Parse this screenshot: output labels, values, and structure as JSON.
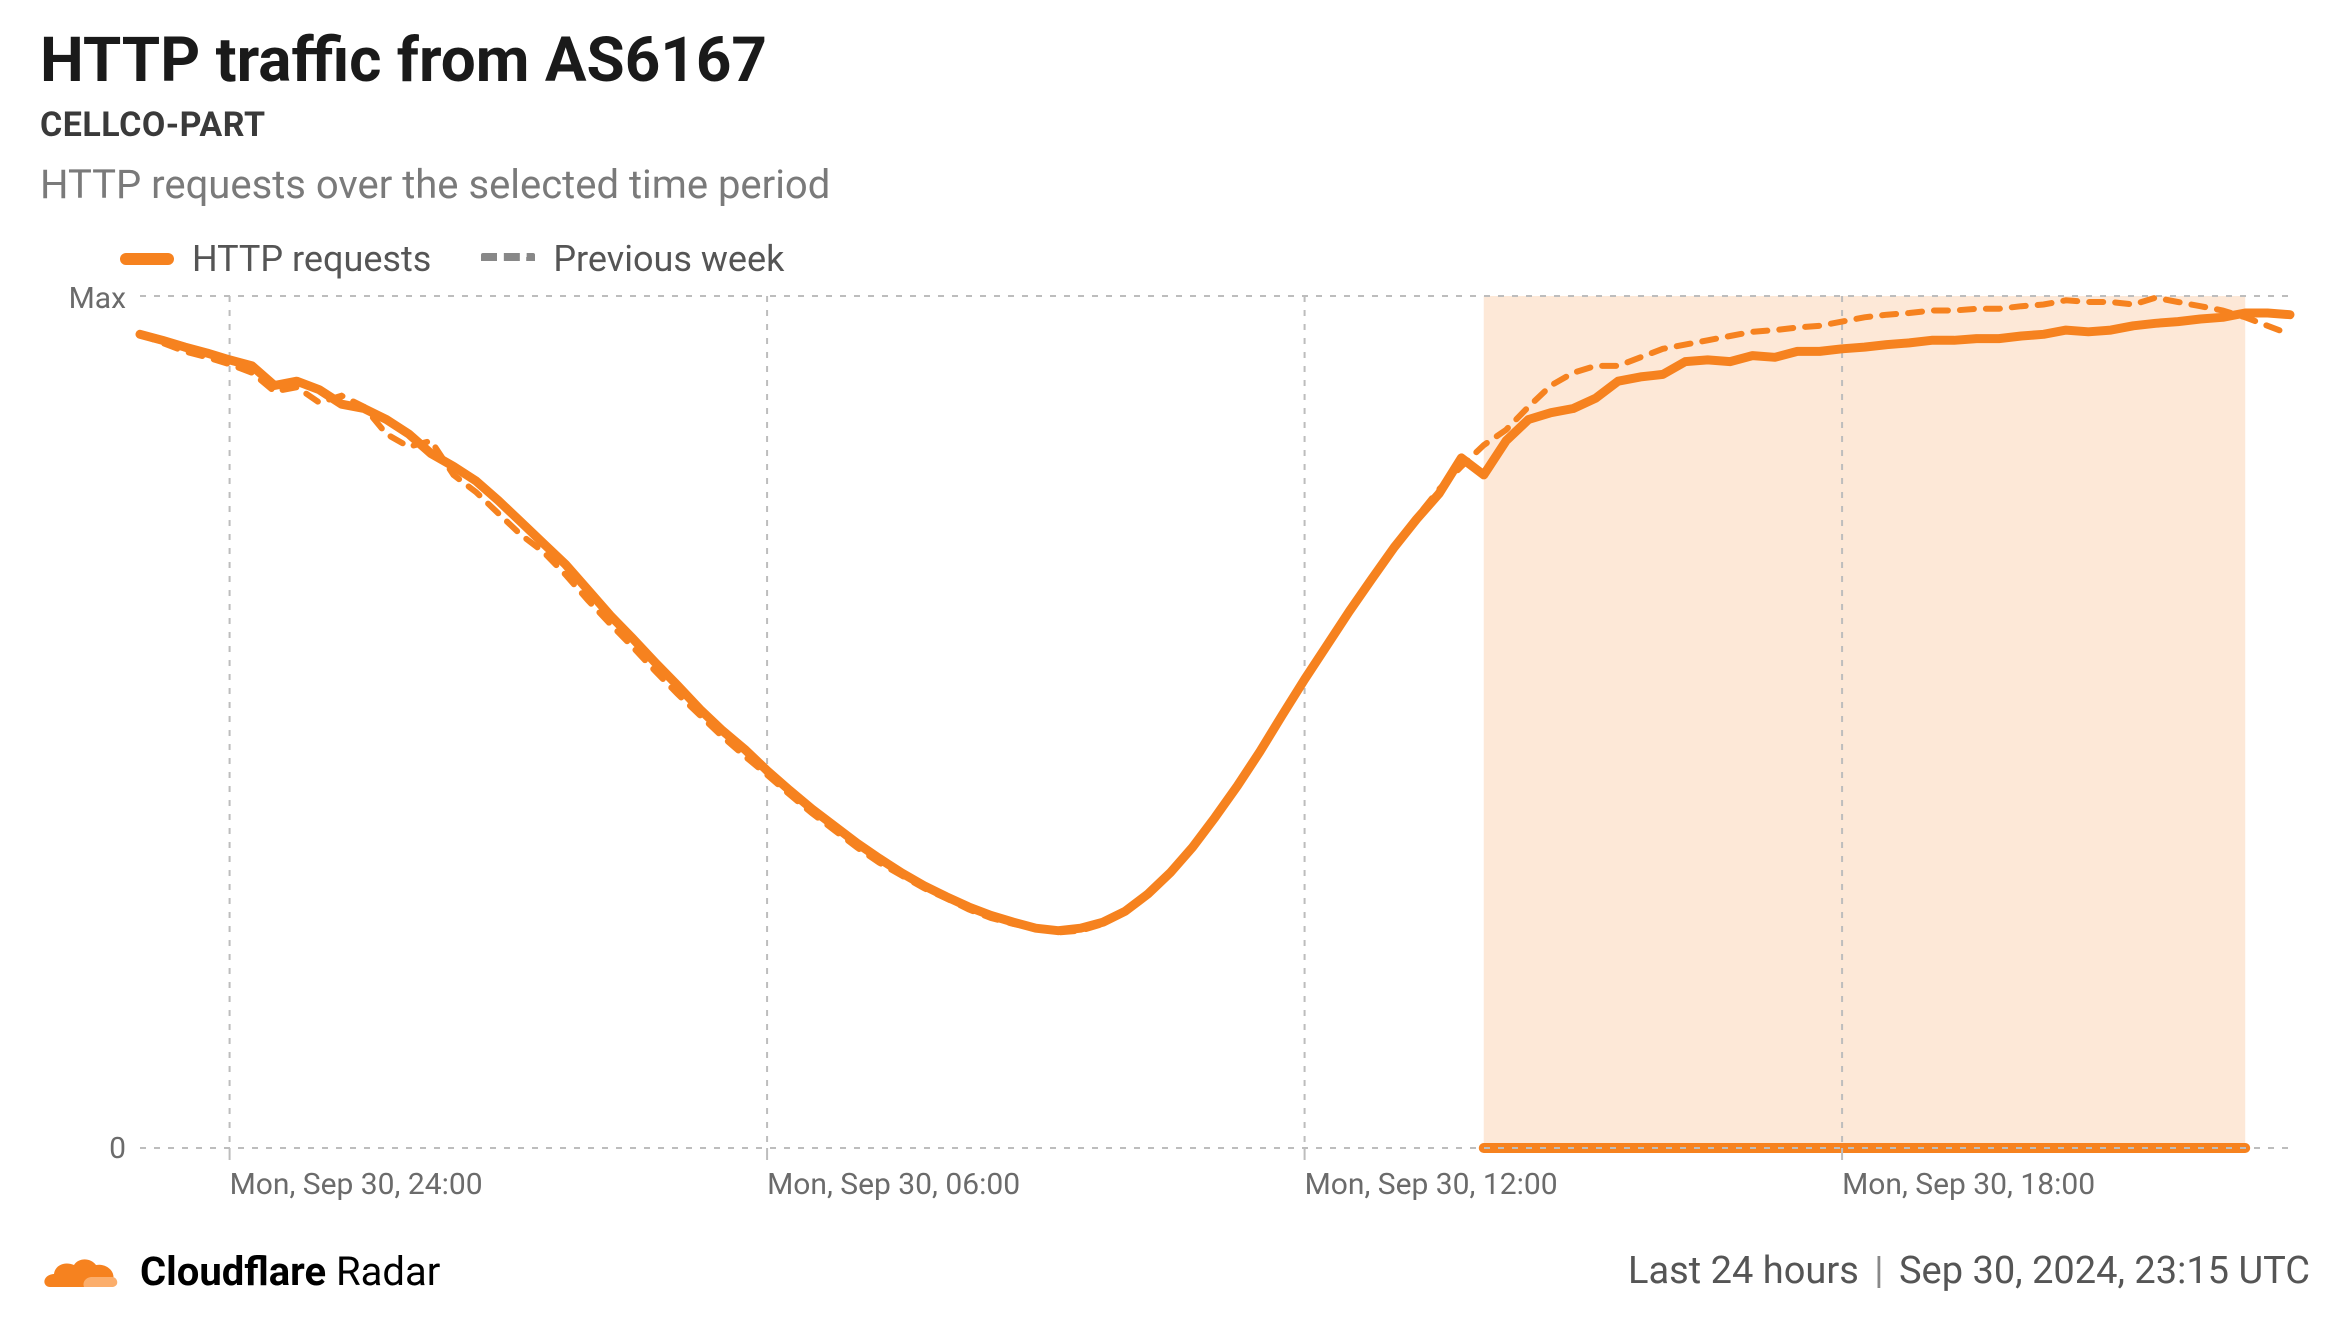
{
  "title": "HTTP traffic from AS6167",
  "subtitle": "CELLCO-PART",
  "description": "HTTP requests over the selected time period",
  "legend": {
    "series1": "HTTP requests",
    "series2": "Previous week"
  },
  "footer": {
    "brand_bold": "Cloudflare",
    "brand_rest": " Radar",
    "range": "Last 24 hours",
    "timestamp": "Sep 30, 2024, 23:15 UTC"
  },
  "axis": {
    "y_max_label": "Max",
    "y_min_label": "0",
    "x_ticks": [
      "Mon, Sep 30, 24:00",
      "Mon, Sep 30, 06:00",
      "Mon, Sep 30, 12:00",
      "Mon, Sep 30, 18:00"
    ]
  },
  "colors": {
    "accent": "#f6821f",
    "highlight_fill": "rgba(246,130,31,0.18)",
    "grid": "#bdbdbd",
    "tickText": "#6b6b6b"
  },
  "chart_data": {
    "type": "line",
    "xlabel": "",
    "ylabel": "",
    "ylim": [
      0,
      1
    ],
    "y_tick_labels": [
      "0",
      "Max"
    ],
    "x_tick_labels": [
      "Mon, Sep 30, 24:00",
      "Mon, Sep 30, 06:00",
      "Mon, Sep 30, 12:00",
      "Mon, Sep 30, 18:00"
    ],
    "x_tick_hours": [
      0,
      6,
      12,
      18
    ],
    "highlight_region_hours": [
      14,
      22.5
    ],
    "x_hours": [
      -1.0,
      -0.75,
      -0.5,
      -0.25,
      0.0,
      0.25,
      0.5,
      0.75,
      1.0,
      1.25,
      1.5,
      1.75,
      2.0,
      2.25,
      2.5,
      2.75,
      3.0,
      3.25,
      3.5,
      3.75,
      4.0,
      4.25,
      4.5,
      4.75,
      5.0,
      5.25,
      5.5,
      5.75,
      6.0,
      6.25,
      6.5,
      6.75,
      7.0,
      7.25,
      7.5,
      7.75,
      8.0,
      8.25,
      8.5,
      8.75,
      9.0,
      9.25,
      9.5,
      9.75,
      10.0,
      10.25,
      10.5,
      10.75,
      11.0,
      11.25,
      11.5,
      11.75,
      12.0,
      12.25,
      12.5,
      12.75,
      13.0,
      13.25,
      13.5,
      13.75,
      14.0,
      14.25,
      14.5,
      14.75,
      15.0,
      15.25,
      15.5,
      15.75,
      16.0,
      16.25,
      16.5,
      16.75,
      17.0,
      17.25,
      17.5,
      17.75,
      18.0,
      18.25,
      18.5,
      18.75,
      19.0,
      19.25,
      19.5,
      19.75,
      20.0,
      20.25,
      20.5,
      20.75,
      21.0,
      21.25,
      21.5,
      21.75,
      22.0,
      22.25,
      22.5,
      22.75,
      23.0
    ],
    "series": [
      {
        "name": "HTTP requests",
        "style": "solid",
        "values": [
          0.955,
          0.948,
          0.94,
          0.933,
          0.925,
          0.918,
          0.895,
          0.9,
          0.89,
          0.873,
          0.868,
          0.855,
          0.838,
          0.815,
          0.8,
          0.783,
          0.76,
          0.735,
          0.71,
          0.685,
          0.655,
          0.625,
          0.598,
          0.57,
          0.543,
          0.515,
          0.49,
          0.468,
          0.443,
          0.42,
          0.398,
          0.378,
          0.358,
          0.34,
          0.323,
          0.308,
          0.295,
          0.283,
          0.273,
          0.265,
          0.258,
          0.255,
          0.258,
          0.265,
          0.278,
          0.298,
          0.323,
          0.353,
          0.388,
          0.425,
          0.465,
          0.508,
          0.55,
          0.59,
          0.63,
          0.668,
          0.705,
          0.738,
          0.768,
          0.81,
          0.79,
          0.83,
          0.855,
          0.863,
          0.868,
          0.88,
          0.9,
          0.905,
          0.908,
          0.923,
          0.925,
          0.923,
          0.93,
          0.928,
          0.935,
          0.935,
          0.938,
          0.94,
          0.943,
          0.945,
          0.948,
          0.948,
          0.95,
          0.95,
          0.953,
          0.955,
          0.96,
          0.958,
          0.96,
          0.965,
          0.968,
          0.97,
          0.973,
          0.975,
          0.98,
          0.98,
          0.978
        ]
      },
      {
        "name": "Previous week",
        "style": "dashed",
        "values": [
          0.955,
          0.945,
          0.935,
          0.928,
          0.92,
          0.91,
          0.888,
          0.893,
          0.875,
          0.883,
          0.87,
          0.838,
          0.823,
          0.83,
          0.79,
          0.77,
          0.745,
          0.72,
          0.7,
          0.673,
          0.643,
          0.615,
          0.588,
          0.56,
          0.533,
          0.508,
          0.483,
          0.46,
          0.438,
          0.415,
          0.393,
          0.373,
          0.353,
          0.335,
          0.32,
          0.305,
          0.293,
          0.28,
          0.27,
          0.263,
          0.258,
          0.253,
          0.255,
          0.263,
          0.278,
          0.298,
          0.323,
          0.353,
          0.388,
          0.425,
          0.465,
          0.508,
          0.548,
          0.588,
          0.628,
          0.668,
          0.705,
          0.74,
          0.773,
          0.8,
          0.825,
          0.843,
          0.87,
          0.895,
          0.91,
          0.918,
          0.918,
          0.928,
          0.938,
          0.943,
          0.948,
          0.953,
          0.958,
          0.96,
          0.963,
          0.965,
          0.97,
          0.975,
          0.978,
          0.98,
          0.983,
          0.983,
          0.985,
          0.985,
          0.988,
          0.99,
          0.995,
          0.993,
          0.993,
          0.99,
          0.998,
          0.993,
          0.988,
          0.983,
          0.975,
          0.965,
          0.955
        ]
      }
    ]
  }
}
